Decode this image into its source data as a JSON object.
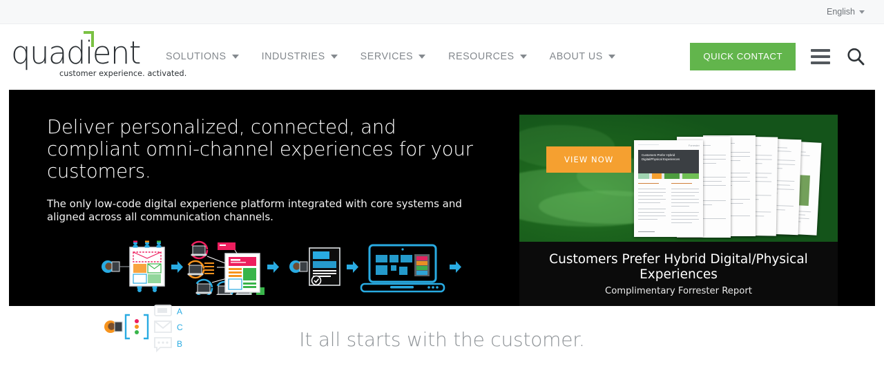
{
  "topbar": {
    "language": "English",
    "caret_icon": "chevron-down-icon"
  },
  "header": {
    "logo": {
      "word": "quadient",
      "tagline": "customer experience. activated.",
      "accent_color": "#7ac143"
    },
    "nav": [
      {
        "label": "SOLUTIONS",
        "caret": "chevron-down-icon"
      },
      {
        "label": "INDUSTRIES",
        "caret": "chevron-down-icon"
      },
      {
        "label": "SERVICES",
        "caret": "chevron-down-icon"
      },
      {
        "label": "RESOURCES",
        "caret": "chevron-down-icon"
      },
      {
        "label": "ABOUT US",
        "caret": "chevron-down-icon"
      }
    ],
    "quick_contact": {
      "label": "QUICK CONTACT",
      "color": "#62b54c"
    },
    "menu_icon": "hamburger-menu-icon",
    "search_icon": "search-icon"
  },
  "hero": {
    "background": "#000000",
    "heading": "Deliver personalized, connected, and compliant omni-channel experiences for your customers.",
    "subheading": "The only low-code digital experience platform integrated with core systems and aligned across all communication channels.",
    "figure": {
      "name": "omni-channel-journey-diagram",
      "channel_labels": [
        "A",
        "C",
        "B"
      ],
      "channel_icons": [
        "mobile-device-icon",
        "envelope-icon",
        "chat-bubble-icon"
      ],
      "arrow_icon": "arrow-right-icon",
      "accent_colors": [
        "#29abe2",
        "#ed1e5e",
        "#f7941e",
        "#39b54a"
      ]
    }
  },
  "promo": {
    "cta": {
      "label": "VIEW NOW",
      "color": "#f5a030"
    },
    "title": "Customers Prefer Hybrid Digital/Physical Experiences",
    "subtitle": "Complimentary Forrester Report",
    "image_alt": "hands-holding-phone-green-overlay",
    "document_title": "Customers Prefer Hybrid Digital/Physical Experiences",
    "document_brand": "Forrester"
  },
  "bottom": {
    "heading": "It all starts with the customer."
  }
}
